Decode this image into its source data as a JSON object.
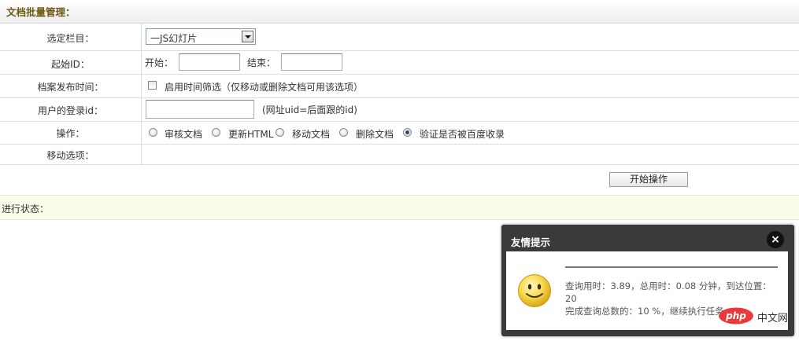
{
  "header": {
    "title": "文档批量管理："
  },
  "form": {
    "category": {
      "label": "选定栏目：",
      "selected": "一JS幻灯片"
    },
    "id_range": {
      "label": "起始ID：",
      "start_label": "开始：",
      "end_label": "结束：",
      "start_value": "",
      "end_value": ""
    },
    "pubdate": {
      "label": "档案发布时间：",
      "checkbox_label": "启用时间筛选（仅移动或删除文档可用该选项）",
      "checked": false
    },
    "user_id": {
      "label": "用户的登录id：",
      "value": "",
      "hint": "(网址uid=后面跟的id)"
    },
    "operation": {
      "label": "操作：",
      "options": [
        "审核文档",
        "更新HTML",
        "移动文档",
        "删除文档",
        "验证是否被百度收录"
      ],
      "selected": "验证是否被百度收录"
    },
    "move": {
      "label": "移动选项："
    },
    "submit_label": "开始操作"
  },
  "status": {
    "label": "进行状态："
  },
  "popup": {
    "title": "友情提示",
    "close": "×",
    "icon": "smiley-face-icon",
    "line1": "查询用时：3.89，总用时：0.08 分钟，到达位置：20",
    "line2": "完成查询总数的：10 %，继续执行任务"
  },
  "watermark": {
    "text": "php 中文网",
    "brand_color": "#e83a3a"
  }
}
